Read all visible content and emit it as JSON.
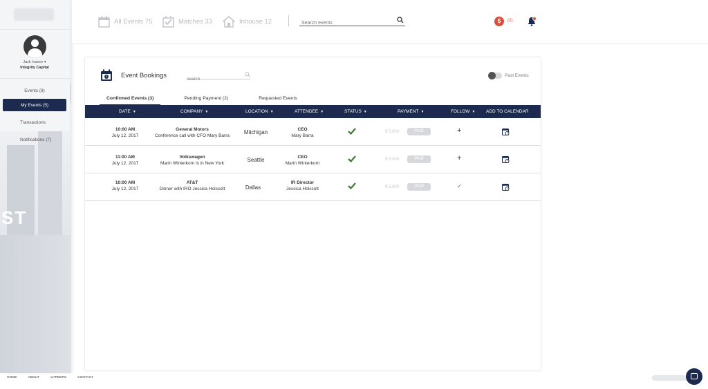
{
  "app": {
    "colors": {
      "navy": "#1b2a4e",
      "accent_red": "#d9513d",
      "check_green": "#3c7a2f"
    }
  },
  "sidebar": {
    "user_name": "Jack Ivanov ▾",
    "user_org": "Integrity Capital",
    "items": [
      {
        "label": "Events (8)",
        "active": false
      },
      {
        "label": "My Events (5)",
        "active": true
      },
      {
        "label": "Transactions",
        "active": false
      },
      {
        "label": "Notifications (7)",
        "active": false
      }
    ],
    "background_text": "ST"
  },
  "topbar": {
    "stats": [
      {
        "icon": "calendar-icon",
        "label": "All Events 75"
      },
      {
        "icon": "checkbox-icon",
        "label": "Matches 33"
      },
      {
        "icon": "house-icon",
        "label": "Inhouse 12"
      }
    ],
    "search_placeholder": "Search events",
    "money_badge": "$",
    "money_count": "(2)"
  },
  "card": {
    "title": "Event Bookings",
    "search_placeholder": "Search",
    "toggle_label": "Past Events",
    "tabs": [
      {
        "label": "Confirmed Events (3)",
        "active": true
      },
      {
        "label": "Pending Payment (2)",
        "active": false
      },
      {
        "label": "Requested Events",
        "active": false
      }
    ],
    "columns": [
      "DATE",
      "COMPANY",
      "LOCATION",
      "ATTENDEE",
      "STATUS",
      "PAYMENT",
      "FOLLOW",
      "ADD TO CALENDAR"
    ],
    "rows": [
      {
        "time": "10:00 AM",
        "date": "July 12, 2017",
        "company": "General Motors",
        "note": "Conference call with CFO Mary Barra",
        "location": "Mitchigan",
        "attendee_title": "CEO",
        "attendee_name": "Mary Barra",
        "amount": "$ 5,000",
        "payment": "PAID",
        "follow": "+"
      },
      {
        "time": "11:00 AM",
        "date": "July 12, 2017",
        "company": "Volkswagen",
        "note": "Marin Winterkorn is in New York",
        "location": "Seattle",
        "attendee_title": "CEO",
        "attendee_name": "Marin Winterkorn",
        "amount": "$ 5,000",
        "payment": "PAID",
        "follow": "+"
      },
      {
        "time": "10:00 AM",
        "date": "July 12, 2017",
        "company": "AT&T",
        "note": "Dinner with IRO Jessica Holscott",
        "location": "Dallas",
        "attendee_title": "IR Director",
        "attendee_name": "Jessica Holscott",
        "amount": "$ 5,000",
        "payment": "PAID",
        "follow": "✓"
      }
    ]
  },
  "footer": {
    "links": [
      "HOME",
      "ABOUT",
      "CAREERS",
      "CONTACT"
    ]
  }
}
